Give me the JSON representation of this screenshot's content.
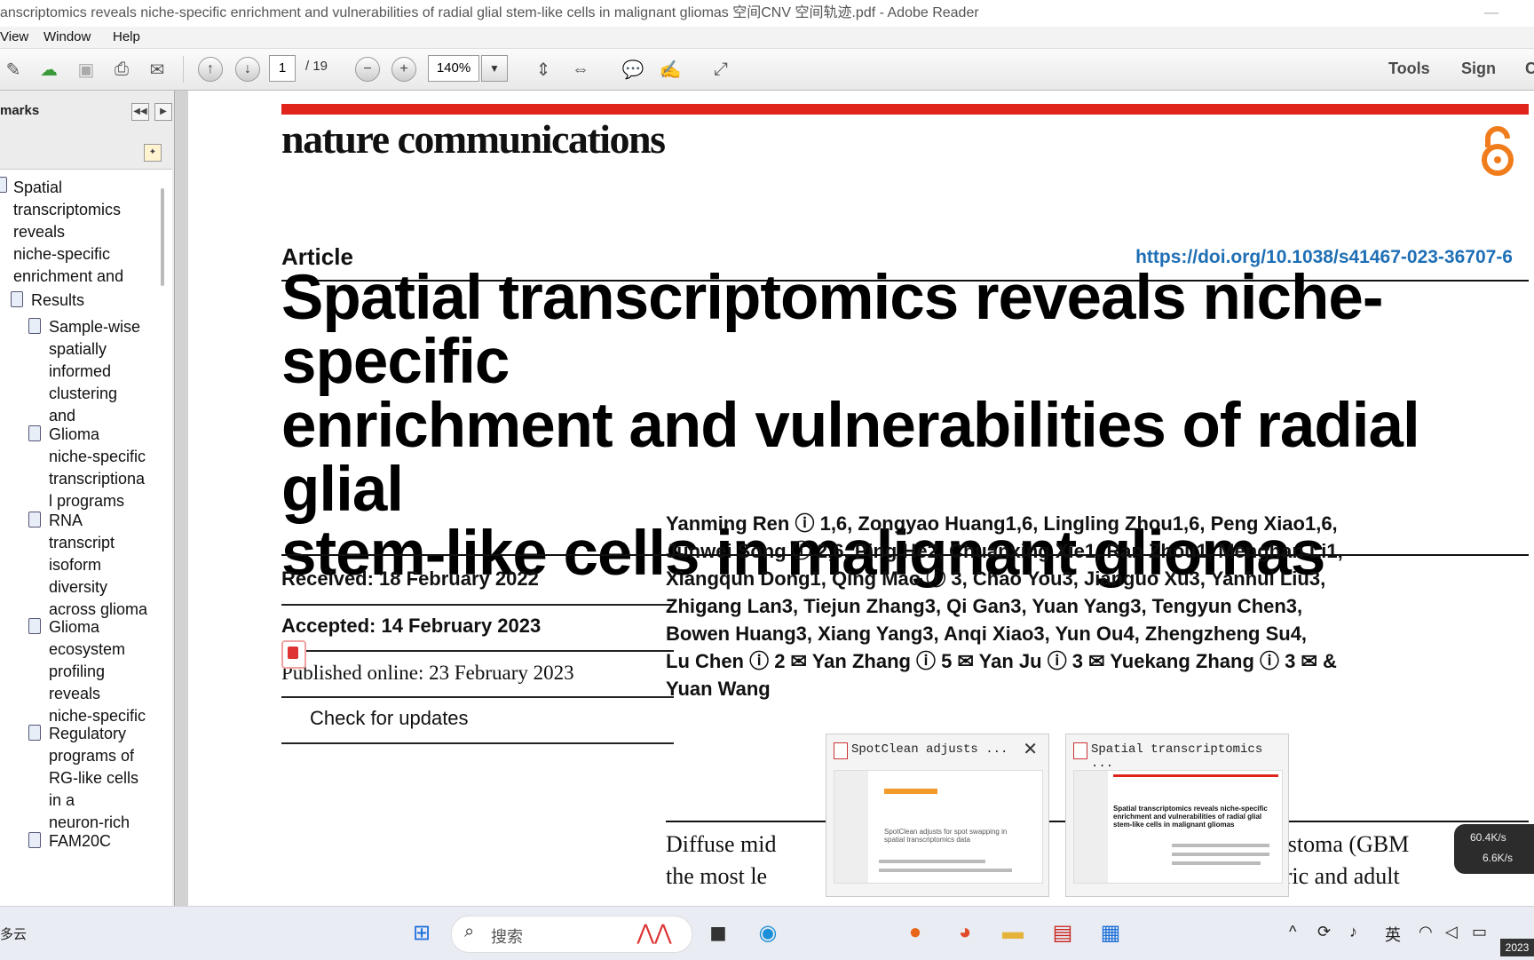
{
  "window": {
    "title": "anscriptomics reveals niche-specific enrichment and vulnerabilities of radial glial  stem-like cells in malignant gliomas   空间CNV  空间轨迹.pdf - Adobe Reader",
    "minimize_glyph": "—"
  },
  "menu": {
    "items": [
      "View",
      "Window",
      "Help"
    ]
  },
  "toolbar": {
    "current_page": "1",
    "page_total": "/ 19",
    "zoom": "140%",
    "tools_label": "Tools",
    "sign_label": "Sign",
    "comment_label": "C"
  },
  "sidebar": {
    "header": "marks",
    "bookmarks": [
      "Spatial",
      "transcriptomics",
      "reveals",
      "niche-specific",
      "enrichment and"
    ],
    "results_label": "Results",
    "sub_items": [
      [
        "Sample-wise",
        "spatially",
        "informed",
        "clustering",
        "and"
      ],
      [
        "Glioma",
        "niche-specific",
        "transcriptiona",
        "l programs"
      ],
      [
        "RNA",
        "transcript",
        "isoform",
        "diversity",
        "across glioma"
      ],
      [
        "Glioma",
        "ecosystem",
        "profiling",
        "reveals",
        "niche-specific"
      ],
      [
        "Regulatory",
        "programs of",
        "RG-like cells",
        "in a",
        "neuron-rich"
      ],
      [
        "FAM20C"
      ]
    ]
  },
  "document": {
    "journal": "nature communications",
    "article_type": "Article",
    "doi": "https://doi.org/10.1038/s41467-023-36707-6",
    "title_lines": [
      "Spatial transcriptomics reveals niche-specific",
      "enrichment and vulnerabilities of radial glial",
      "stem-like cells in malignant gliomas"
    ],
    "received": "Received: 18 February 2022",
    "accepted": "Accepted: 14 February 2023",
    "published": "Published online: 23 February 2023",
    "check_updates": "Check for updates",
    "author_lines": [
      "Yanming Ren ⓘ 1,6, Zongyao Huang1,6, Lingling Zhou1,6, Peng Xiao1,6,",
      "Junwei Song ⓘ 2,6, Ping He2, Chuanxing Xie1, Ran Zhou1, Menghan Li1,",
      "Xiangqun Dong1, Qing Mao ⓘ 3, Chao You3, Jianguo Xu3, Yanhui Liu3,",
      "Zhigang Lan3, Tiejun Zhang3, Qi Gan3, Yuan Yang3, Tengyun Chen3,",
      "Bowen Huang3, Xiang Yang3, Anqi Xiao3, Yun Ou4, Zhengzheng Su4,",
      "Lu Chen ⓘ 2 ✉ Yan Zhang ⓘ 5 ✉ Yan Ju ⓘ 3 ✉ Yuekang Zhang ⓘ 3 ✉ &",
      "Yuan Wang"
    ],
    "abstract_line1_left": "Diffuse mid",
    "abstract_line1_right": "blastoma (GBM",
    "abstract_line2_left": "the most le",
    "abstract_line2_right": "atric and adult"
  },
  "previews": [
    {
      "title": "SpotClean adjusts ...",
      "thumb_text": "SpotClean adjusts for spot swapping in spatial transcriptomics data"
    },
    {
      "title": "Spatial transcriptomics ...",
      "thumb_text": "Spatial transcriptomics reveals niche-specific enrichment and vulnerabilities of radial glial stem-like cells in malignant gliomas"
    }
  ],
  "netspeed": {
    "up": "60.4K/s",
    "down": "6.6K/s"
  },
  "taskbar": {
    "weather": "多云",
    "search_placeholder": "搜索",
    "ime": "英",
    "clock": "2023"
  },
  "colors": {
    "accent_red": "#e0241c",
    "doi_blue": "#1f6fb5"
  }
}
